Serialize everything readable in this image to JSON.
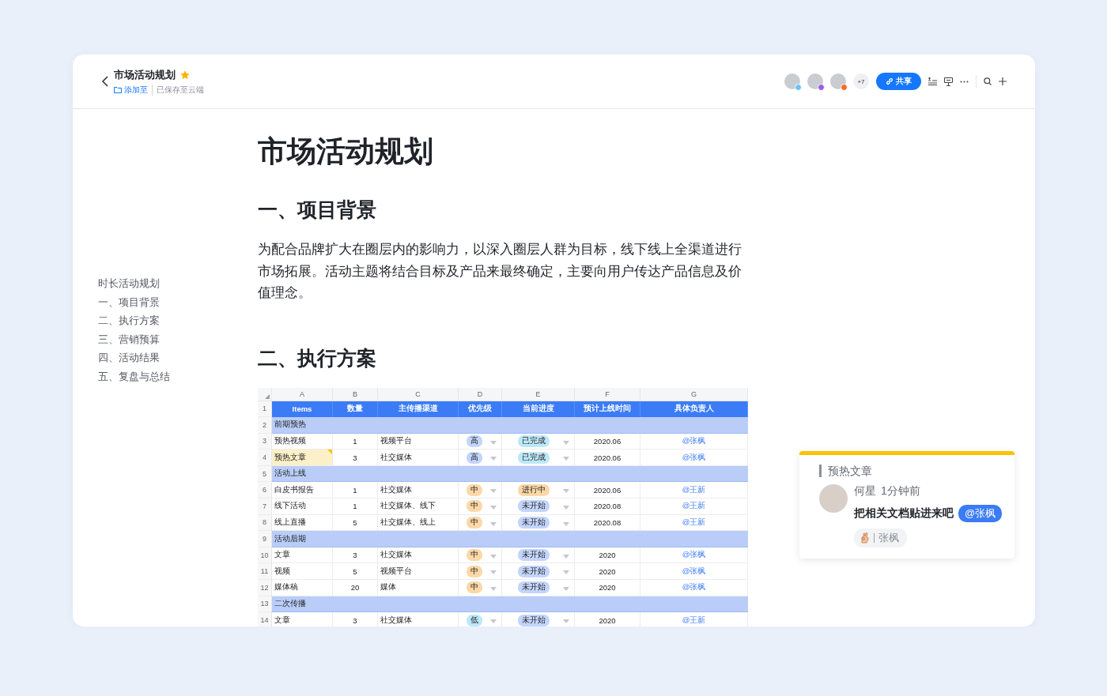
{
  "header": {
    "title": "市场活动规划",
    "favorite": true,
    "add_to": "添加至",
    "save_status": "已保存至云端",
    "collaborators": [
      {
        "color": "#6cc3f5"
      },
      {
        "color": "#9b5de5"
      },
      {
        "color": "#f46b2a"
      }
    ],
    "more_count": "+7",
    "share_button": "共享"
  },
  "outline": [
    "时长活动规划",
    "一、项目背景",
    "二、执行方案",
    "三、营销预算",
    "四、活动结果",
    "五、复盘与总结"
  ],
  "document": {
    "title": "市场活动规划",
    "sections": [
      {
        "heading": "一、项目背景",
        "paragraph": "为配合品牌扩大在圈层内的影响力，以深入圈层人群为目标，线下线上全渠道进行市场拓展。活动主题将结合目标及产品来最终确定，主要向用户传达产品信息及价值理念。"
      },
      {
        "heading": "二、执行方案"
      }
    ]
  },
  "sheet": {
    "column_letters": [
      "A",
      "B",
      "C",
      "D",
      "E",
      "F",
      "G"
    ],
    "header": {
      "num": "1",
      "cells": [
        "Items",
        "数量",
        "主传播渠道",
        "优先级",
        "当前进度",
        "预计上线时间",
        "具体负责人"
      ]
    },
    "rows": [
      {
        "kind": "group",
        "num": "2",
        "label": "前期预热"
      },
      {
        "kind": "item",
        "num": "3",
        "highlighted": false,
        "cells": [
          "预热视频",
          "1",
          "视频平台"
        ],
        "priority": {
          "text": "高",
          "color": "#c3d5fb"
        },
        "progress": {
          "text": "已完成",
          "color": "#bde8f8"
        },
        "date": "2020.06",
        "owner": "@张枫"
      },
      {
        "kind": "item",
        "num": "4",
        "highlighted": true,
        "cells": [
          "预热文章",
          "3",
          "社交媒体"
        ],
        "priority": {
          "text": "高",
          "color": "#c3d5fb"
        },
        "progress": {
          "text": "已完成",
          "color": "#bde8f8"
        },
        "date": "2020.06",
        "owner": "@张枫"
      },
      {
        "kind": "group",
        "num": "5",
        "label": "活动上线"
      },
      {
        "kind": "item",
        "num": "6",
        "highlighted": false,
        "cells": [
          "白皮书报告",
          "1",
          "社交媒体"
        ],
        "priority": {
          "text": "中",
          "color": "#fcd8a9"
        },
        "progress": {
          "text": "进行中",
          "color": "#fcd8a9"
        },
        "date": "2020.06",
        "owner": "@王新"
      },
      {
        "kind": "item",
        "num": "7",
        "highlighted": false,
        "cells": [
          "线下活动",
          "1",
          "社交媒体、线下"
        ],
        "priority": {
          "text": "中",
          "color": "#fcd8a9"
        },
        "progress": {
          "text": "未开始",
          "color": "#c3d5fb"
        },
        "date": "2020.08",
        "owner": "@王新"
      },
      {
        "kind": "item",
        "num": "8",
        "highlighted": false,
        "cells": [
          "线上直播",
          "5",
          "社交媒体、线上"
        ],
        "priority": {
          "text": "中",
          "color": "#fcd8a9"
        },
        "progress": {
          "text": "未开始",
          "color": "#c3d5fb"
        },
        "date": "2020.08",
        "owner": "@王新"
      },
      {
        "kind": "group",
        "num": "9",
        "label": "活动后期"
      },
      {
        "kind": "item",
        "num": "10",
        "highlighted": false,
        "cells": [
          "文章",
          "3",
          "社交媒体"
        ],
        "priority": {
          "text": "中",
          "color": "#fcd8a9"
        },
        "progress": {
          "text": "未开始",
          "color": "#c3d5fb"
        },
        "date": "2020",
        "owner": "@张枫"
      },
      {
        "kind": "item",
        "num": "11",
        "highlighted": false,
        "cells": [
          "视频",
          "5",
          "视频平台"
        ],
        "priority": {
          "text": "中",
          "color": "#fcd8a9"
        },
        "progress": {
          "text": "未开始",
          "color": "#c3d5fb"
        },
        "date": "2020",
        "owner": "@张枫"
      },
      {
        "kind": "item",
        "num": "12",
        "highlighted": false,
        "cells": [
          "媒体稿",
          "20",
          "媒体"
        ],
        "priority": {
          "text": "中",
          "color": "#fcd8a9"
        },
        "progress": {
          "text": "未开始",
          "color": "#c3d5fb"
        },
        "date": "2020",
        "owner": "@张枫"
      },
      {
        "kind": "group",
        "num": "13",
        "label": "二次传播"
      },
      {
        "kind": "item",
        "num": "14",
        "highlighted": false,
        "cells": [
          "文章",
          "3",
          "社交媒体"
        ],
        "priority": {
          "text": "低",
          "color": "#bde8f8"
        },
        "progress": {
          "text": "未开始",
          "color": "#c3d5fb"
        },
        "date": "2020",
        "owner": "@王新"
      }
    ]
  },
  "comment": {
    "quote": "预热文章",
    "author": "何星",
    "time": "1分钟前",
    "message": "把相关文档贴进来吧",
    "mention": "@张枫",
    "reaction_user": "张枫"
  }
}
